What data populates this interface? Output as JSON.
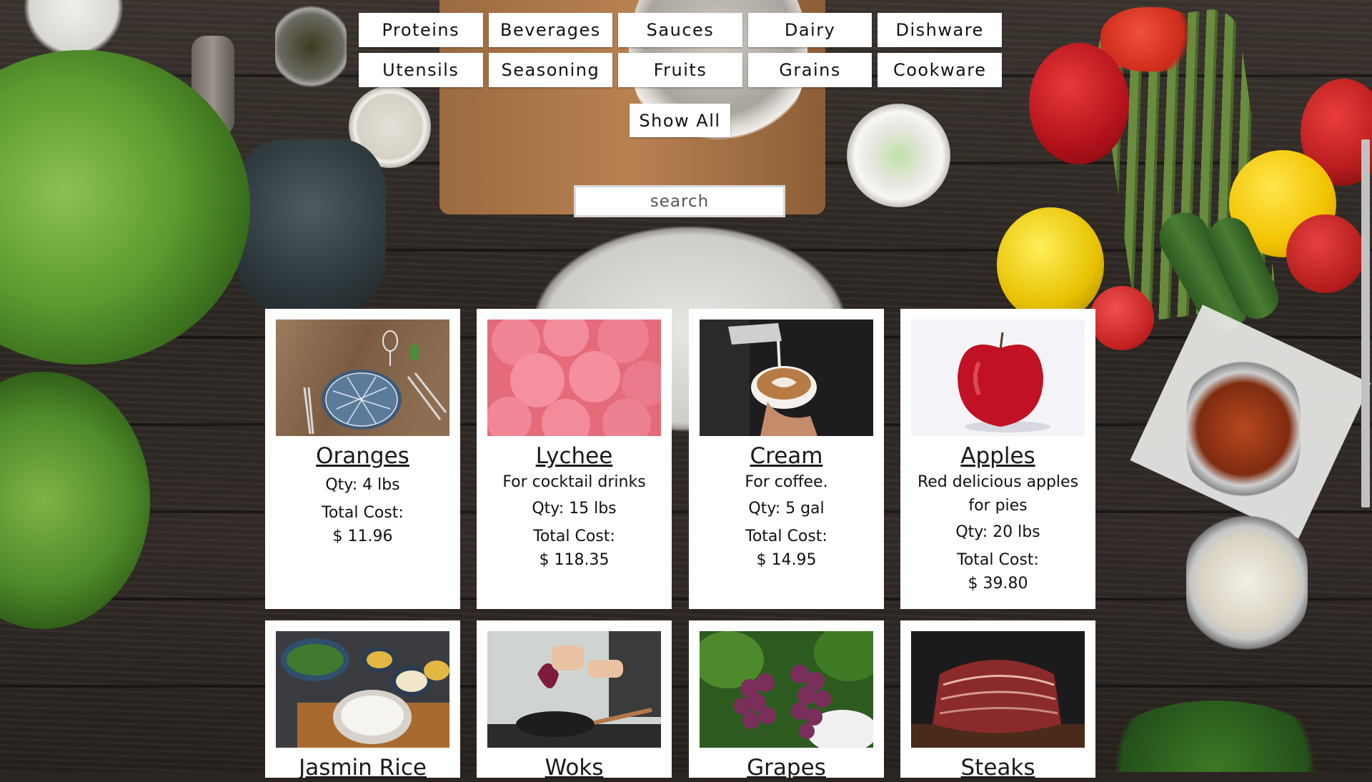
{
  "filters": {
    "row1": [
      "Proteins",
      "Beverages",
      "Sauces",
      "Dairy",
      "Dishware"
    ],
    "row2": [
      "Utensils",
      "Seasoning",
      "Fruits",
      "Grains",
      "Cookware"
    ],
    "show_all": "Show All"
  },
  "search": {
    "placeholder": "search",
    "value": ""
  },
  "items": [
    {
      "name": "Oranges",
      "desc": "",
      "qty": "Qty: 4 lbs",
      "cost_label": "Total Cost:",
      "cost": "$ 11.96"
    },
    {
      "name": "Lychee",
      "desc": "For cocktail drinks",
      "qty": "Qty: 15 lbs",
      "cost_label": "Total Cost:",
      "cost": "$ 118.35"
    },
    {
      "name": "Cream",
      "desc": "For coffee.",
      "qty": "Qty: 5 gal",
      "cost_label": "Total Cost:",
      "cost": "$ 14.95"
    },
    {
      "name": "Apples",
      "desc": "Red delicious apples for pies",
      "qty": "Qty: 20 lbs",
      "cost_label": "Total Cost:",
      "cost": "$ 39.80"
    },
    {
      "name": "Jasmin Rice"
    },
    {
      "name": "Woks"
    },
    {
      "name": "Grapes"
    },
    {
      "name": "Steaks"
    }
  ]
}
